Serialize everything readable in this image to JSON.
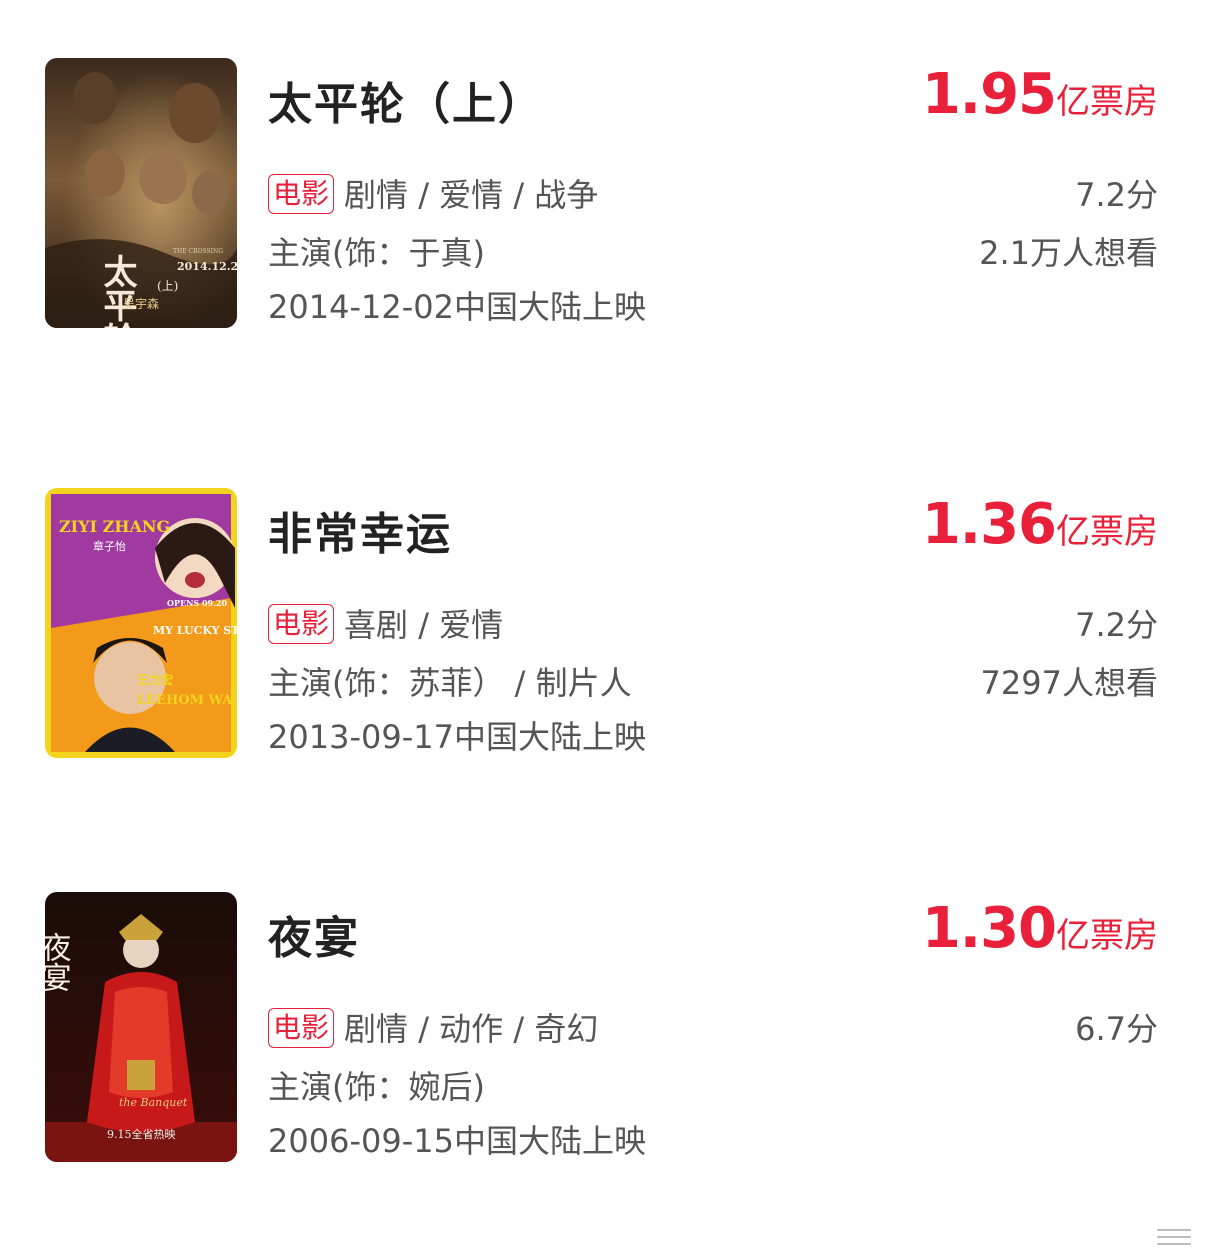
{
  "movies": [
    {
      "title": "太平轮（上）",
      "box_office_number": "1.95",
      "box_office_unit": "亿票房",
      "tag": "电影",
      "genres": "剧情 / 爱情 / 战争",
      "rating": "7.2分",
      "role": "主演(饰：于真)",
      "want": "2.1万人想看",
      "release": "2014-12-02中国大陆上映",
      "poster": {
        "name": "taipinglun-poster",
        "text_main": "太平轮",
        "text_sub": "(上)",
        "date": "2014.12.2",
        "english": "THE CROSSING",
        "director": "吴宇森"
      }
    },
    {
      "title": "非常幸运",
      "box_office_number": "1.36",
      "box_office_unit": "亿票房",
      "tag": "电影",
      "genres": "喜剧 / 爱情",
      "rating": "7.2分",
      "role": "主演(饰：苏菲） / 制片人",
      "want": "7297人想看",
      "release": "2013-09-17中国大陆上映",
      "poster": {
        "name": "my-lucky-star-poster",
        "ziyi": "ZIYI ZHANG",
        "ziyi_cn": "章子怡",
        "opens": "OPENS 09.20",
        "title_en": "MY LUCKY STAR",
        "wang": "王力宏",
        "leehom": "LEEHOM WANG"
      }
    },
    {
      "title": "夜宴",
      "box_office_number": "1.30",
      "box_office_unit": "亿票房",
      "tag": "电影",
      "genres": "剧情 / 动作 / 奇幻",
      "rating": "6.7分",
      "role": "主演(饰：婉后)",
      "want": "",
      "release": "2006-09-15中国大陆上映",
      "poster": {
        "name": "banquet-poster",
        "title_cn": "夜宴",
        "title_en": "the Banquet",
        "date": "9.15全省热映"
      }
    }
  ],
  "colors": {
    "accent": "#e8203a",
    "text": "#222222",
    "secondary": "#555555"
  }
}
